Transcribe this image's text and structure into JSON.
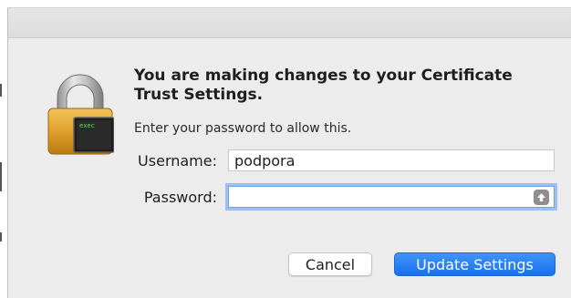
{
  "dialog": {
    "heading": "You are making changes to your Certificate Trust Settings.",
    "subtext": "Enter your password to allow this.",
    "lock_icon": {
      "name": "lock-icon",
      "badge_text": "exec"
    },
    "username": {
      "label": "Username:",
      "value": "podpora"
    },
    "password": {
      "label": "Password:",
      "value": "",
      "placeholder": ""
    },
    "buttons": {
      "cancel": "Cancel",
      "update": "Update Settings"
    }
  },
  "colors": {
    "accent": "#1a6ff0",
    "focus_ring": "#9ec0f0",
    "dialog_bg": "#ececec"
  }
}
